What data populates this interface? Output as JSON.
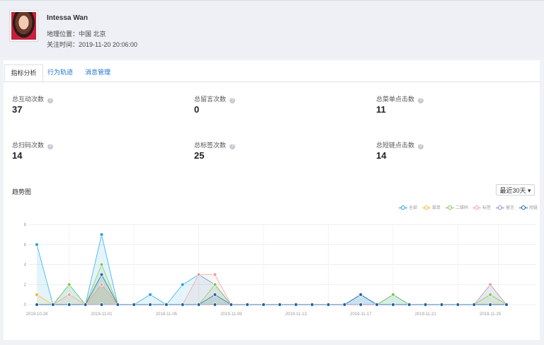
{
  "profile": {
    "name": "Intessa Wan",
    "location": "地理位置：中国 北京",
    "follow_time": "关注时间：2019-11-20 20:06:00"
  },
  "tabs": [
    {
      "label": "指标分析",
      "active": true
    },
    {
      "label": "行为轨迹",
      "active": false
    },
    {
      "label": "消息管理",
      "active": false
    }
  ],
  "metrics": [
    {
      "label": "总互动次数",
      "value": "37"
    },
    {
      "label": "总留言次数",
      "value": "0"
    },
    {
      "label": "总菜单点击数",
      "value": "11"
    },
    {
      "label": "总扫码次数",
      "value": "14"
    },
    {
      "label": "总标签次数",
      "value": "25"
    },
    {
      "label": "总短链点击数",
      "value": "14"
    }
  ],
  "trend": {
    "title": "趋势图",
    "range": "最近30天 ▾"
  },
  "help_glyph": "?",
  "chart_data": {
    "type": "line",
    "ylim": [
      0,
      8
    ],
    "yticks": [
      0,
      2,
      4,
      6,
      8
    ],
    "xtick_labels": [
      "2019-10-28",
      "2019-11-01",
      "2019-11-05",
      "2019-11-09",
      "2019-11-13",
      "2019-11-17",
      "2019-11-21",
      "2019-11-25"
    ],
    "x": [
      "2019-10-28",
      "2019-10-29",
      "2019-10-30",
      "2019-10-31",
      "2019-11-01",
      "2019-11-02",
      "2019-11-03",
      "2019-11-04",
      "2019-11-05",
      "2019-11-06",
      "2019-11-07",
      "2019-11-08",
      "2019-11-09",
      "2019-11-10",
      "2019-11-11",
      "2019-11-12",
      "2019-11-13",
      "2019-11-14",
      "2019-11-15",
      "2019-11-16",
      "2019-11-17",
      "2019-11-18",
      "2019-11-19",
      "2019-11-20",
      "2019-11-21",
      "2019-11-22",
      "2019-11-23",
      "2019-11-24",
      "2019-11-25",
      "2019-11-26"
    ],
    "series": [
      {
        "name": "全部",
        "color": "#1aa3e0",
        "values": [
          6,
          0,
          2,
          0,
          7,
          0,
          0,
          1,
          0,
          2,
          3,
          2,
          0,
          0,
          0,
          0,
          0,
          0,
          0,
          0,
          1,
          0,
          1,
          0,
          0,
          0,
          0,
          0,
          2,
          0
        ]
      },
      {
        "name": "菜单",
        "color": "#f5b72a",
        "values": [
          1,
          0,
          0,
          0,
          2,
          0,
          0,
          0,
          0,
          0,
          0,
          0,
          0,
          0,
          0,
          0,
          0,
          0,
          0,
          0,
          0,
          0,
          0,
          0,
          0,
          0,
          0,
          0,
          0,
          0
        ]
      },
      {
        "name": "二维码",
        "color": "#7ec64a",
        "values": [
          0,
          0,
          2,
          0,
          4,
          0,
          0,
          0,
          0,
          0,
          0,
          2,
          0,
          0,
          0,
          0,
          0,
          0,
          0,
          0,
          0,
          0,
          1,
          0,
          0,
          0,
          0,
          0,
          1,
          0
        ]
      },
      {
        "name": "标签",
        "color": "#f2999b",
        "values": [
          0,
          0,
          1,
          0,
          2,
          0,
          0,
          0,
          0,
          0,
          3,
          3,
          0,
          0,
          0,
          0,
          0,
          0,
          0,
          0,
          0,
          0,
          0,
          0,
          0,
          0,
          0,
          0,
          2,
          0
        ]
      },
      {
        "name": "留言",
        "color": "#9a86c9",
        "values": [
          0,
          0,
          0,
          0,
          0,
          0,
          0,
          0,
          0,
          0,
          0,
          0,
          0,
          0,
          0,
          0,
          0,
          0,
          0,
          0,
          0,
          0,
          0,
          0,
          0,
          0,
          0,
          0,
          0,
          0
        ]
      },
      {
        "name": "短链",
        "color": "#1764a8",
        "values": [
          0,
          0,
          0,
          0,
          3,
          0,
          0,
          0,
          0,
          0,
          0,
          1,
          0,
          0,
          0,
          0,
          0,
          0,
          0,
          0,
          1,
          0,
          0,
          0,
          0,
          0,
          0,
          0,
          0,
          0
        ]
      }
    ],
    "grid": true,
    "legend": "top-right"
  }
}
